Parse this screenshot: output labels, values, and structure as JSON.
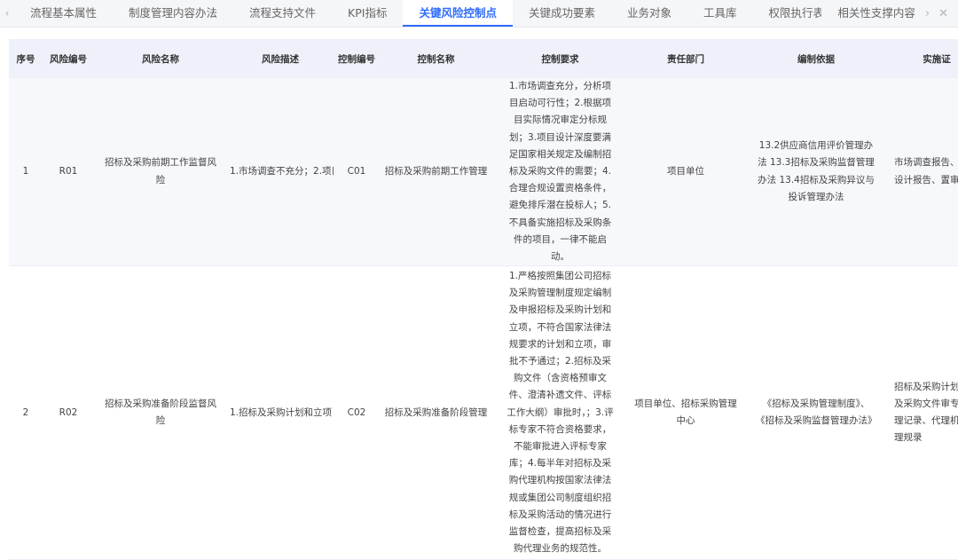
{
  "tabbar": {
    "left_arrow": "‹",
    "tabs": [
      {
        "label": "流程基本属性"
      },
      {
        "label": "制度管理内容办法"
      },
      {
        "label": "流程支持文件"
      },
      {
        "label": "KPI指标"
      },
      {
        "label": "关键风险控制点",
        "active": true
      },
      {
        "label": "关键成功要素"
      },
      {
        "label": "业务对象"
      },
      {
        "label": "工具库"
      },
      {
        "label": "权限执行表"
      }
    ],
    "last_tab": "相关性支撑内容",
    "right_arrow": "›",
    "close": "✕"
  },
  "table": {
    "headers": [
      "序号",
      "风险编号",
      "风险名称",
      "风险描述",
      "控制编号",
      "控制名称",
      "控制要求",
      "责任部门",
      "编制依据",
      "实施证"
    ],
    "rows": [
      {
        "index": "1",
        "risk_no": "R01",
        "risk_name": "招标及采购前期工作监督风险",
        "risk_desc": "1.市场调查不充分；2.项目",
        "ctrl_no": "C01",
        "ctrl_name": "招标及采购前期工作管理",
        "ctrl_req": "1.市场调查充分，分析项目启动可行性；2.根据项目实际情况审定分标规划；3.项目设计深度要满足国家相关规定及编制招标及采购文件的需要；4.合理合规设置资格条件，避免排斥潜在投标人；5.不具备实施招标及采购条件的项目，一律不能启动。",
        "dept": "项目单位",
        "basis": "13.2供应商信用评价管理办法 13.3招标及采购监督管理办法 13.4招标及采购异议与投诉管理办法",
        "evidence": "市场调查报告、招标设计报告、置审批等"
      },
      {
        "index": "2",
        "risk_no": "R02",
        "risk_name": "招标及采购准备阶段监督风险",
        "risk_desc": "1.招标及采购计划和立项",
        "ctrl_no": "C02",
        "ctrl_name": "招标及采购准备阶段管理",
        "ctrl_req": "1.严格按照集团公司招标及采购管理制度规定编制及申报招标及采购计划和立项，不符合国家法律法规要求的计划和立项，审批不予通过；2.招标及采购文件（含资格预审文件、澄清补遗文件、评标工作大纲）审批时，；3.评标专家不符合资格要求，不能审批进入评标专家库；4.每半年对招标及采购代理机构按国家法律法规或集团公司制度组织招标及采购活动的情况进行监督检查，提高招标及采购代理业务的规范性。",
        "dept": "项目单位、招标采购管理中心",
        "basis": "《招标及采购管理制度》、《招标及采购监督管理办法》",
        "evidence": "招标及采购计划、标及采购文件审专家管理记录、代理机构代理规录"
      }
    ]
  }
}
